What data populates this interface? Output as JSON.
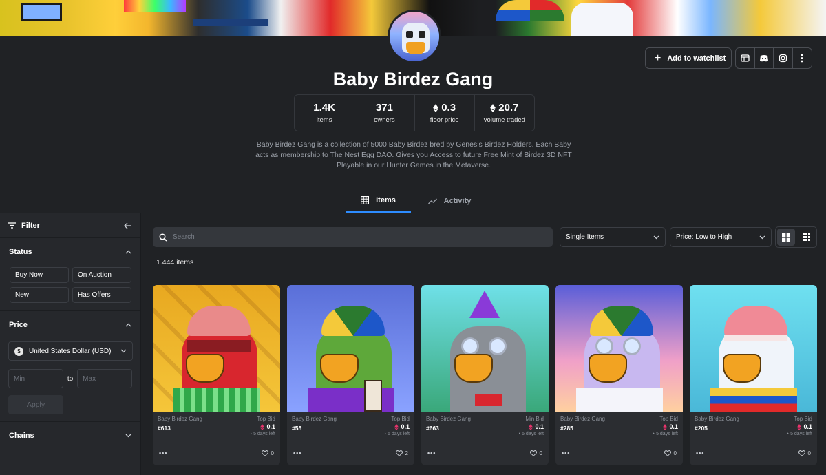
{
  "collection": {
    "title": "Baby Birdez Gang",
    "description": "Baby Birdez Gang is a collection of 5000 Baby Birdez bred by Genesis Birdez Holders. Each Baby acts as membership to The Nest Egg DAO. Gives you Access to future Free Mint of Birdez 3D NFT Playable in our Hunter Games in the Metaverse."
  },
  "header_actions": {
    "watchlist_label": "Add to watchlist",
    "icons": [
      "website-icon",
      "discord-icon",
      "instagram-icon",
      "more-icon"
    ]
  },
  "stats": [
    {
      "value": "1.4K",
      "label": "items",
      "eth": false
    },
    {
      "value": "371",
      "label": "owners",
      "eth": false
    },
    {
      "value": "0.3",
      "label": "floor price",
      "eth": true
    },
    {
      "value": "20.7",
      "label": "volume traded",
      "eth": true
    }
  ],
  "tabs": [
    {
      "label": "Items",
      "active": true
    },
    {
      "label": "Activity",
      "active": false
    }
  ],
  "sidebar": {
    "filter_label": "Filter",
    "status": {
      "title": "Status",
      "options": [
        "Buy Now",
        "On Auction",
        "New",
        "Has Offers"
      ]
    },
    "price": {
      "title": "Price",
      "currency": "United States Dollar (USD)",
      "min_placeholder": "Min",
      "to_label": "to",
      "max_placeholder": "Max",
      "apply_label": "Apply"
    },
    "chains": {
      "title": "Chains"
    }
  },
  "toolbar": {
    "search_placeholder": "Search",
    "item_type": "Single Items",
    "sort": "Price: Low to High"
  },
  "items_count": "1.444 items",
  "colors": {
    "accent": "#2d8cff",
    "eth": "#e8336b",
    "background": "#202225"
  },
  "cards": [
    {
      "collection": "Baby Birdez Gang",
      "number": "#613",
      "bid_label": "Top Bid",
      "bid_value": "0.1",
      "time_left": "5 days left",
      "likes": "0",
      "more": "•••"
    },
    {
      "collection": "Baby Birdez Gang",
      "number": "#55",
      "bid_label": "Top Bid",
      "bid_value": "0.1",
      "time_left": "5 days left",
      "likes": "2",
      "more": "•••"
    },
    {
      "collection": "Baby Birdez Gang",
      "number": "#663",
      "bid_label": "Min Bid",
      "bid_value": "0.1",
      "time_left": "5 days left",
      "likes": "0",
      "more": "•••"
    },
    {
      "collection": "Baby Birdez Gang",
      "number": "#285",
      "bid_label": "Top Bid",
      "bid_value": "0.1",
      "time_left": "5 days left",
      "likes": "0",
      "more": "•••"
    },
    {
      "collection": "Baby Birdez Gang",
      "number": "#205",
      "bid_label": "Top Bid",
      "bid_value": "0.1",
      "time_left": "5 days left",
      "likes": "0",
      "more": "•••"
    }
  ]
}
